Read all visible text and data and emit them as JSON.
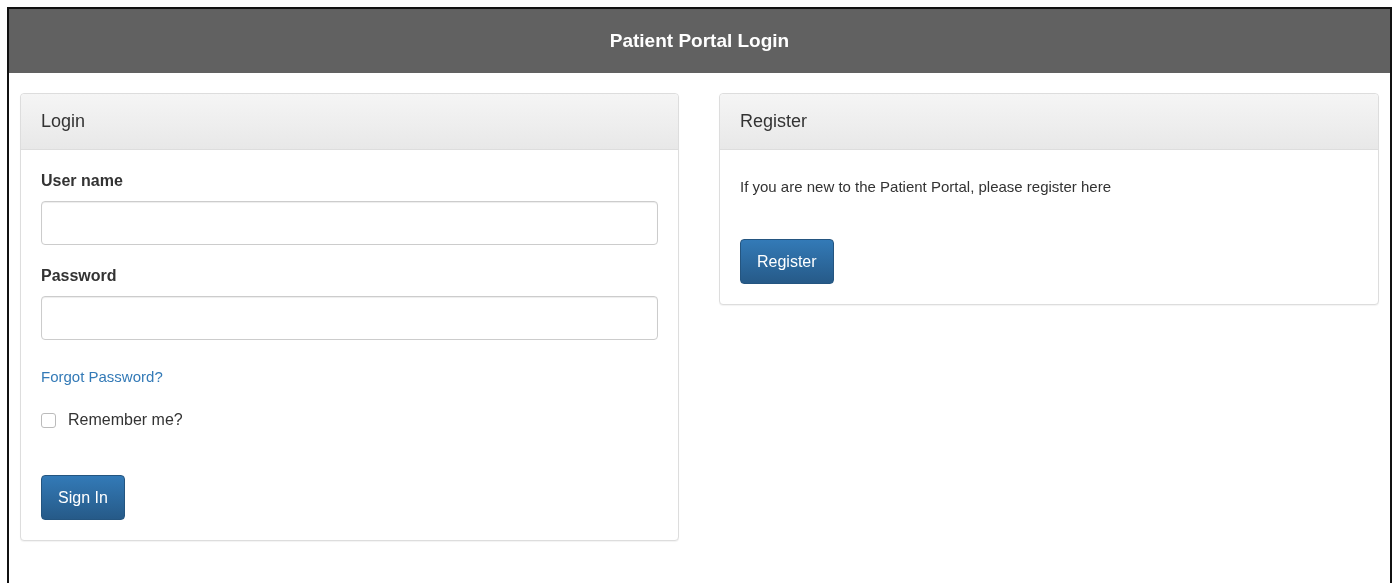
{
  "header": {
    "title": "Patient Portal Login"
  },
  "login_panel": {
    "title": "Login",
    "fields": [
      {
        "label": "User name"
      },
      {
        "label": "Password"
      }
    ],
    "forgot_link": "Forgot Password?",
    "remember": {
      "label": "Remember me?",
      "checked": false
    },
    "button": "Sign In"
  },
  "register_panel": {
    "title": "Register",
    "text": "If you are new to the Patient Portal, please register here",
    "button": "Register"
  }
}
